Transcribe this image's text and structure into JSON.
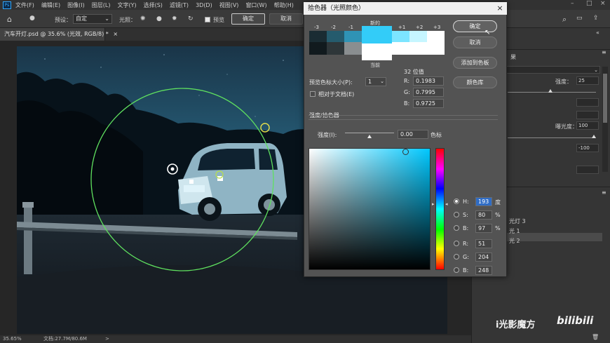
{
  "menubar": {
    "items": [
      "文件(F)",
      "编辑(E)",
      "图像(I)",
      "图层(L)",
      "文字(Y)",
      "选择(S)",
      "滤镜(T)",
      "3D(D)",
      "视图(V)",
      "窗口(W)",
      "帮助(H)"
    ]
  },
  "options": {
    "preset_label": "预设：",
    "preset_value": "自定",
    "light_label": "光照：",
    "preview_label": "预览",
    "ok_label": "确定",
    "cancel_label": "取消"
  },
  "document": {
    "tab_title": "汽车开灯.psd @ 35.6% (光效, RGB/8) *",
    "tab_close": "×"
  },
  "status": {
    "zoom": "35.65%",
    "doc_size": "文档:27.7M/80.6M",
    "arrow": ">"
  },
  "dialog": {
    "title": "拾色器（光照颜色）",
    "close": "×",
    "steps": [
      "-3",
      "-2",
      "-1",
      "+1",
      "+2",
      "+3"
    ],
    "new_label": "新的",
    "current_label": "当前",
    "bits_label": "32 位值",
    "r_label": "R:",
    "r_value": "0.1983",
    "g_label": "G:",
    "g_value": "0.7995",
    "b_label": "B:",
    "b_value": "0.9725",
    "preview_size_label": "预览色标大小(P):",
    "preview_size_value": "1",
    "relative_label": "相对于文档(E)",
    "intensity_section": "强度/拾色器",
    "intensity_label": "强度(I):",
    "intensity_value": "0.00",
    "intensity_unit": "色标",
    "ok": "确定",
    "cancel": "取消",
    "add_swatch": "添加到色板",
    "color_library": "颜色库",
    "hsb_rgb": [
      {
        "label": "H:",
        "value": "193",
        "unit": "度",
        "selected": true
      },
      {
        "label": "S:",
        "value": "80",
        "unit": "%"
      },
      {
        "label": "B:",
        "value": "97",
        "unit": "%"
      },
      {
        "label": "R:",
        "value": "51",
        "unit": ""
      },
      {
        "label": "G:",
        "value": "204",
        "unit": ""
      },
      {
        "label": "B:",
        "value": "248",
        "unit": ""
      }
    ],
    "new_color": "#33ccf8",
    "current_color": "#ffffff"
  },
  "right_panel": {
    "section_label": "果",
    "strength_label": "强度：",
    "strength_value": "25",
    "exposure_label": "曝光度：",
    "exposure_value": "100",
    "value_minus": "-100",
    "layers": [
      "光灯 3",
      "光 1",
      "光 2"
    ]
  },
  "watermark": {
    "text": "i光影魔方",
    "logo": "bilibili"
  }
}
